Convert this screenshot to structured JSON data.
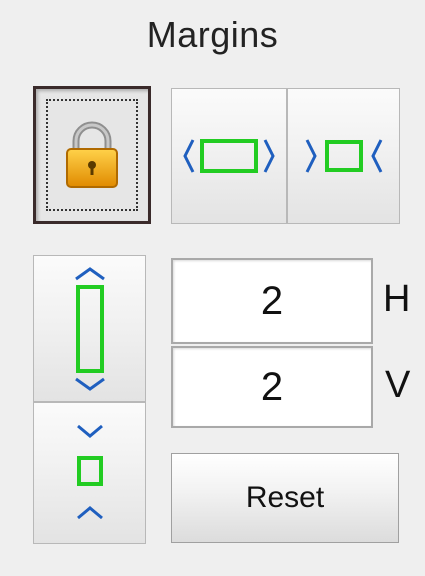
{
  "panel": {
    "title": "Margins"
  },
  "toolbar": {
    "lock": {
      "icon": "padlock-icon",
      "state": "pressed"
    },
    "grow_horizontal": {
      "icon": "expand-horizontal-icon"
    },
    "shrink_horizontal": {
      "icon": "shrink-horizontal-icon"
    },
    "grow_vertical": {
      "icon": "expand-vertical-icon"
    },
    "shrink_vertical": {
      "icon": "shrink-vertical-icon"
    }
  },
  "fields": {
    "horizontal": {
      "value": "2",
      "label": "H"
    },
    "vertical": {
      "value": "2",
      "label": "V"
    }
  },
  "actions": {
    "reset_label": "Reset"
  },
  "colors": {
    "icon_green": "#22cc22",
    "icon_blue": "#1f5fbf",
    "lock_gold": "#f2a500",
    "background": "#efefef"
  }
}
